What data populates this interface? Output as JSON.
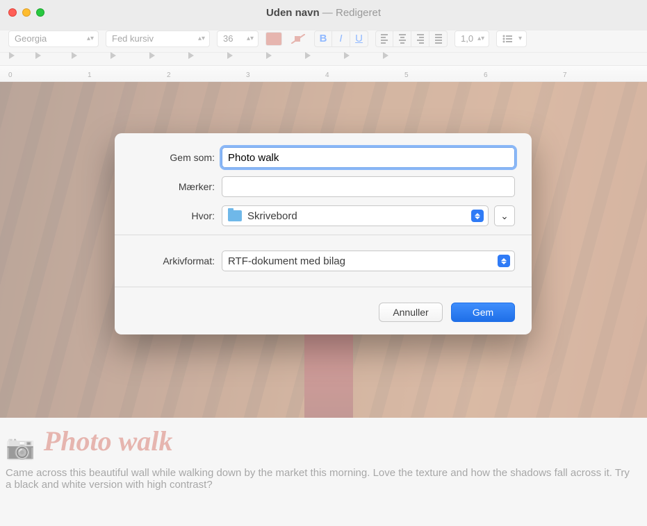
{
  "window": {
    "title": "Uden navn",
    "subtitle_sep": " — ",
    "subtitle": "Redigeret"
  },
  "toolbar": {
    "font": "Georgia",
    "style": "Fed kursiv",
    "size": "36",
    "spacing": "1,0",
    "bold": "B",
    "italic": "I",
    "underline": "U"
  },
  "ruler": {
    "marks": [
      "0",
      "1",
      "2",
      "3",
      "4",
      "5",
      "6",
      "7"
    ]
  },
  "document": {
    "camera_emoji": "📷",
    "heading": "Photo walk",
    "body": "Came across this beautiful wall while walking down by the market this morning. Love the texture and how the shadows fall across it. Try a black and white version with high contrast?"
  },
  "dialog": {
    "save_as_label": "Gem som:",
    "save_as_value": "Photo walk",
    "tags_label": "Mærker:",
    "where_label": "Hvor:",
    "where_value": "Skrivebord",
    "format_label": "Arkivformat:",
    "format_value": "RTF-dokument med bilag",
    "cancel": "Annuller",
    "save": "Gem"
  }
}
